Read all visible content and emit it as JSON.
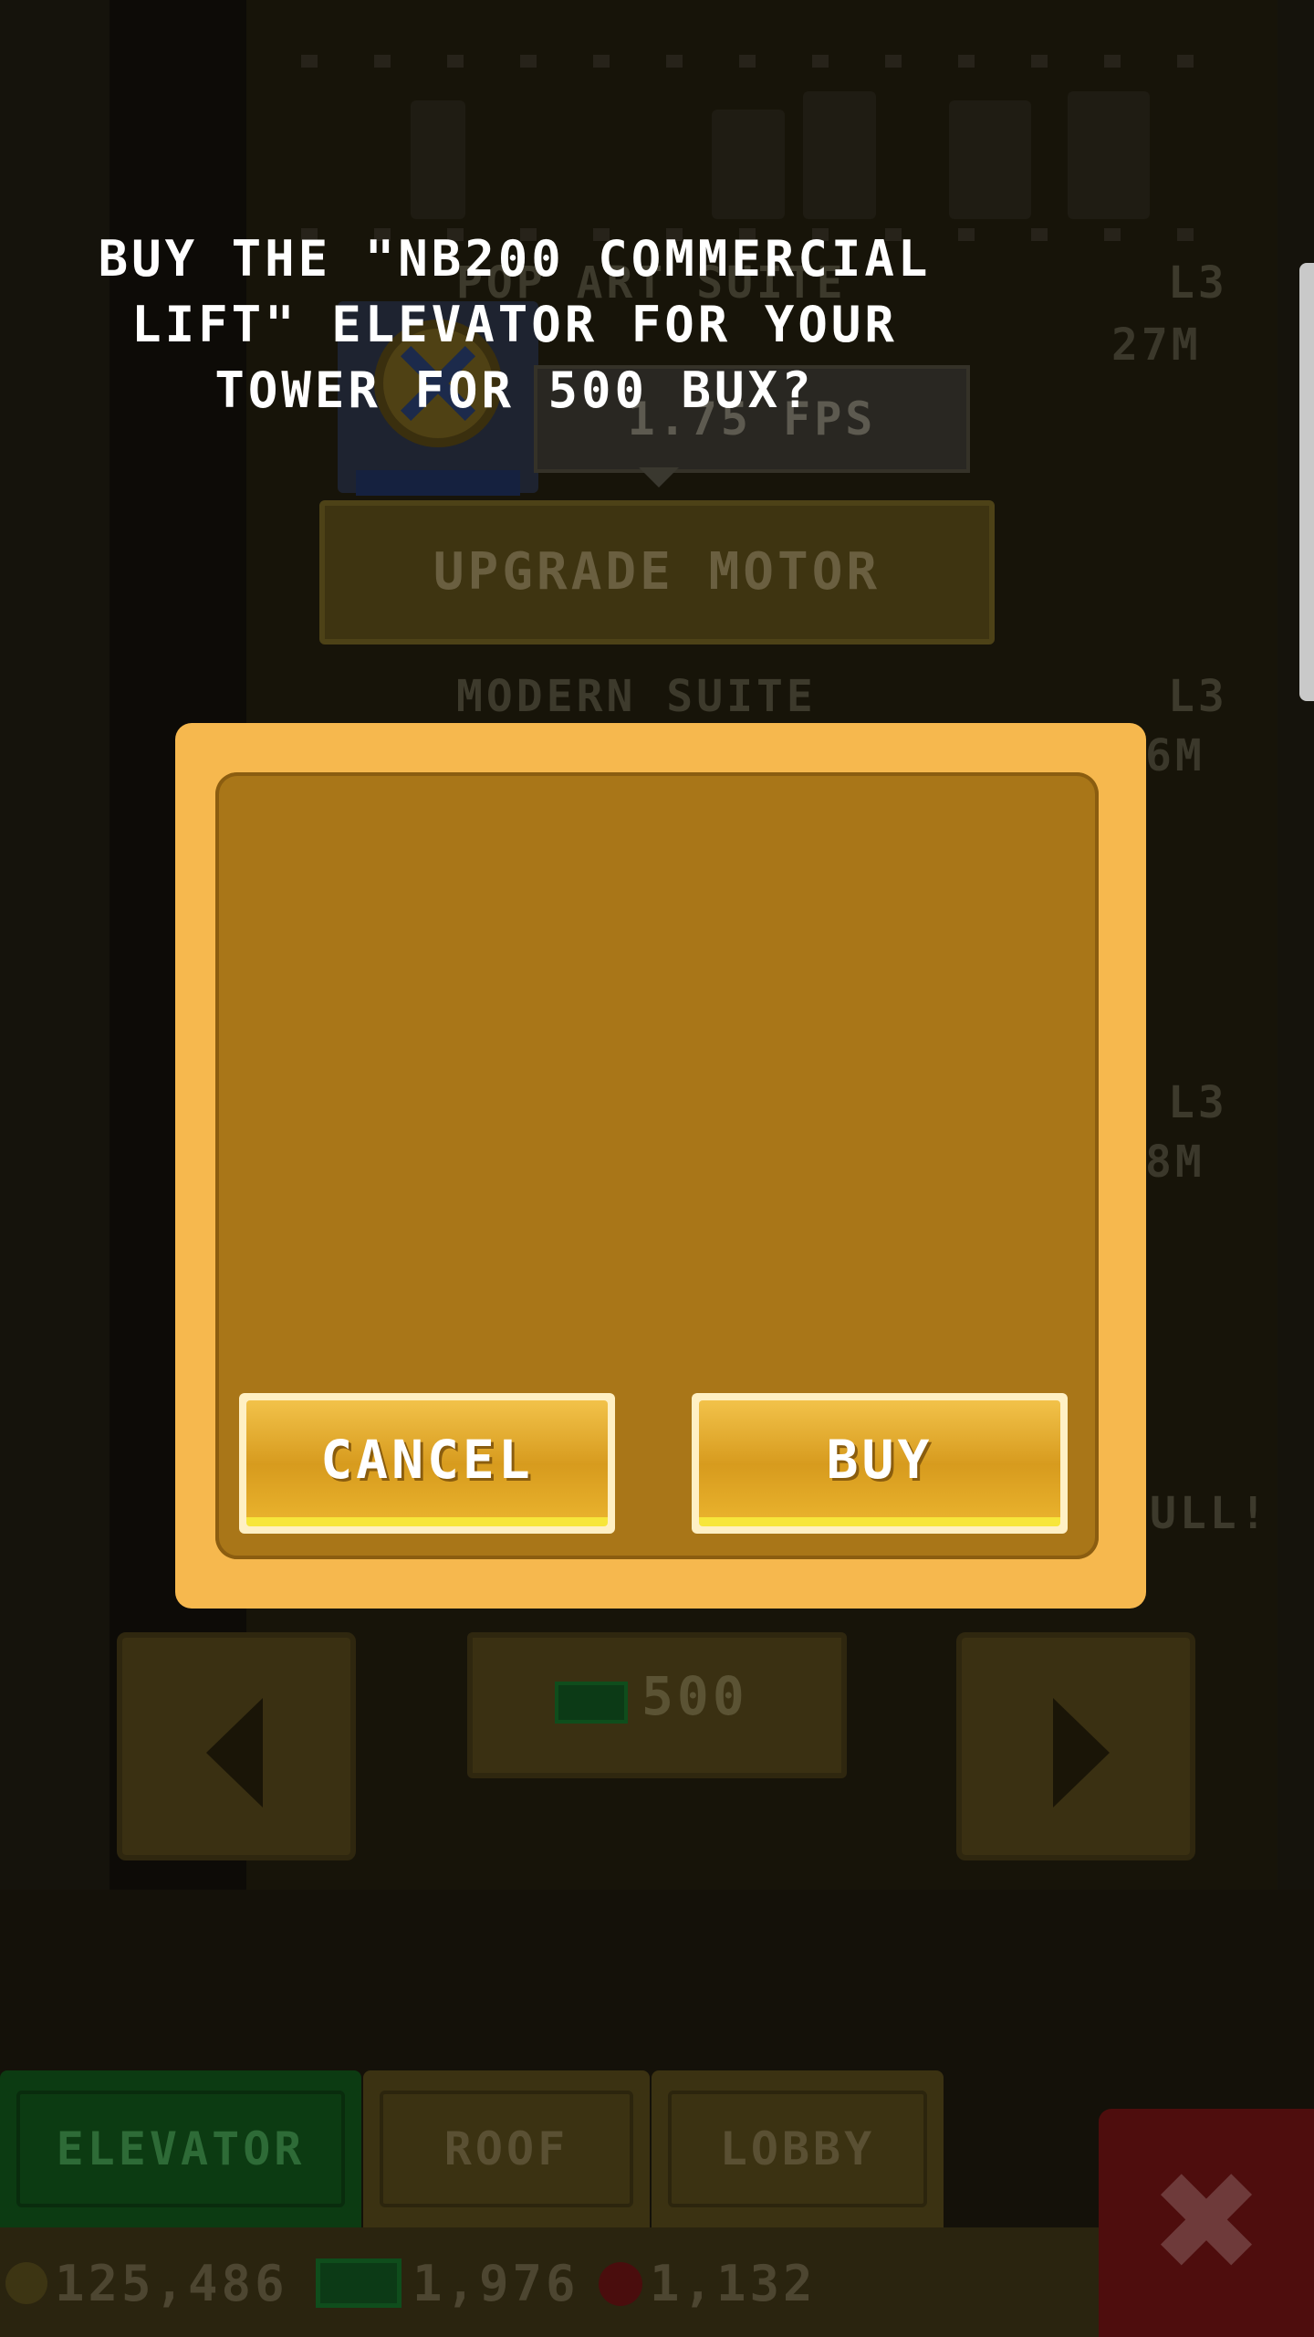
{
  "scene": {
    "floors": [
      {
        "name": "POP ART SUITE",
        "level": "L3",
        "price": "27M"
      },
      {
        "name": "MODERN SUITE",
        "level": "L3",
        "price": "6M"
      },
      {
        "name": "",
        "level": "L3",
        "price": "8M"
      }
    ],
    "side_text": "ULL!",
    "motor": {
      "speed": "1.75 FPS",
      "upgrade_label": "UPGRADE MOTOR"
    },
    "elevator_price": "500"
  },
  "dialog": {
    "message": "BUY THE \"NB200 COMMERCIAL LIFT\" ELEVATOR FOR YOUR TOWER FOR 500 BUX?",
    "cancel_label": "CANCEL",
    "buy_label": "BUY"
  },
  "tabs": [
    {
      "label": "ELEVATOR",
      "active": true
    },
    {
      "label": "ROOF",
      "active": false
    },
    {
      "label": "LOBBY",
      "active": false
    }
  ],
  "currency": {
    "coins": "125,486",
    "bux": "1,976",
    "gems": "1,132"
  },
  "colors": {
    "dialog_border": "#f6b84e",
    "dialog_fill": "#a97618",
    "button_fill": "#d79b1e",
    "tab_active": "#0c3b12",
    "close_button": "#4e0d0d"
  },
  "icons": {
    "coin": "coin-icon",
    "bux": "bux-bill-icon",
    "gem": "gem-icon",
    "close": "close-icon",
    "nav_left": "arrow-left-icon",
    "nav_right": "arrow-right-icon",
    "motor": "motor-icon"
  }
}
